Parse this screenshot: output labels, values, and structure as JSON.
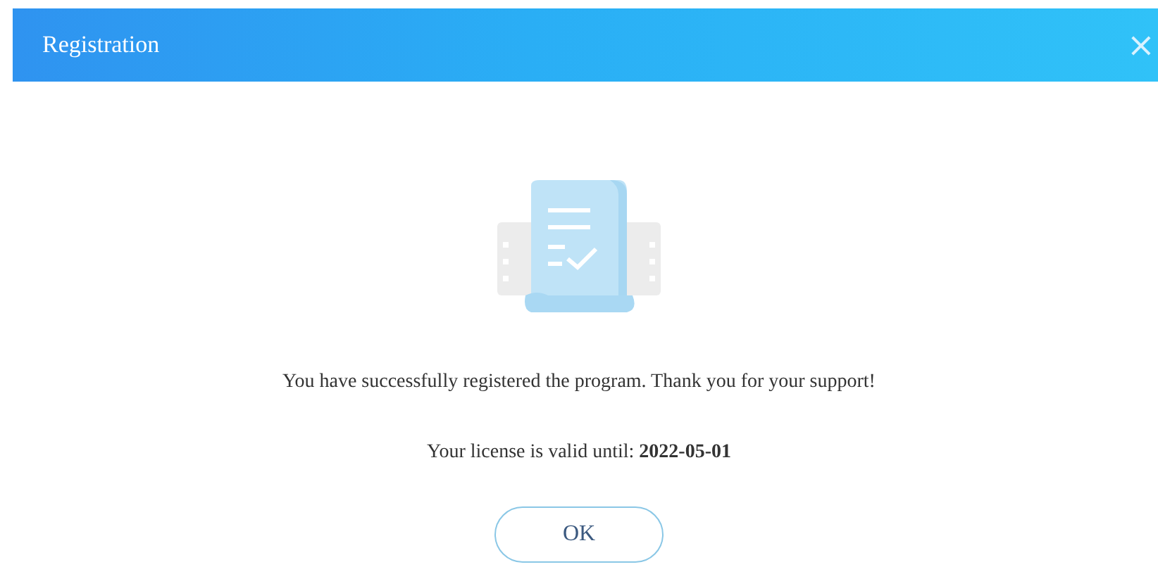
{
  "window": {
    "title": "Registration",
    "close": "×"
  },
  "message": "You have successfully registered the program. Thank you for your support!",
  "license": "Your license is valid until: **2022-05-01**",
  "buttons": [
    "OK"
  ]
}
